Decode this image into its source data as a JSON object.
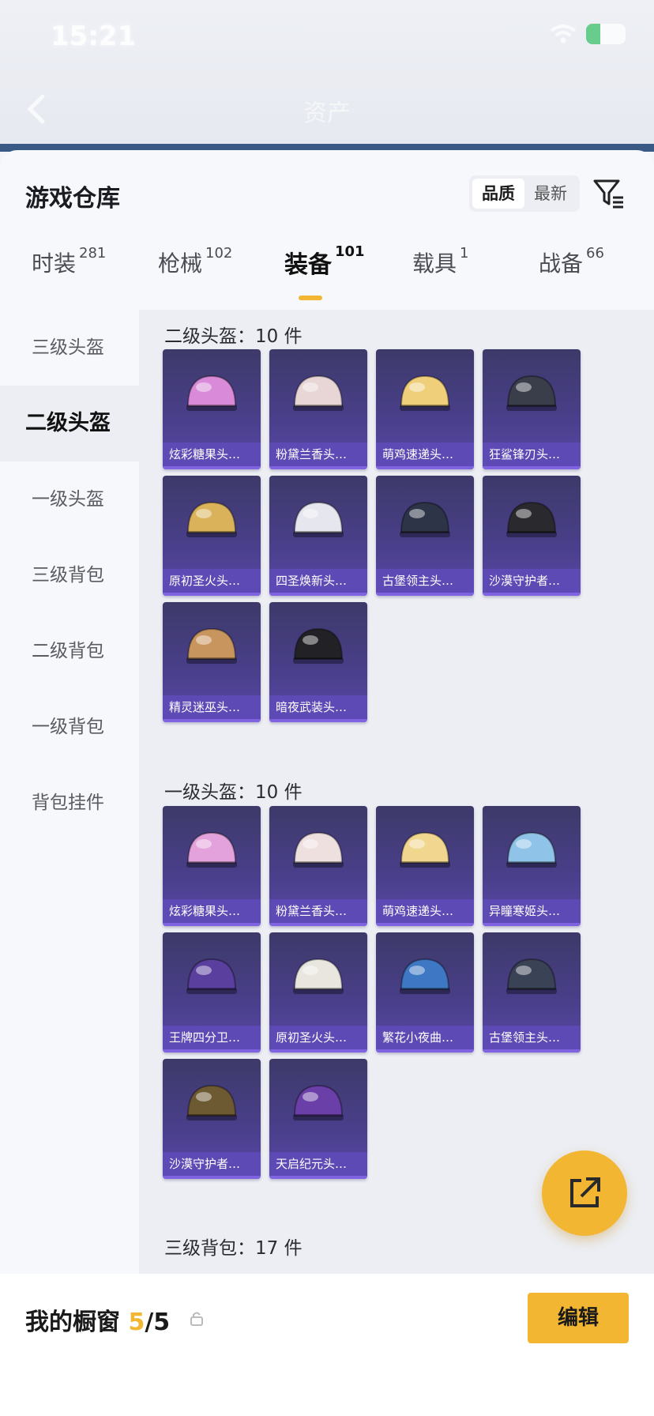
{
  "status_bar": {
    "time": "15:21"
  },
  "nav": {
    "title": "资产"
  },
  "header": {
    "title": "游戏仓库",
    "sort_options": [
      "品质",
      "最新"
    ],
    "active_sort": "品质"
  },
  "tabs": [
    {
      "label": "时装",
      "count": "281"
    },
    {
      "label": "枪械",
      "count": "102"
    },
    {
      "label": "装备",
      "count": "101",
      "active": true
    },
    {
      "label": "载具",
      "count": "1"
    },
    {
      "label": "战备",
      "count": "66"
    }
  ],
  "sidebar": [
    {
      "label": "三级头盔"
    },
    {
      "label": "二级头盔",
      "active": true
    },
    {
      "label": "一级头盔"
    },
    {
      "label": "三级背包"
    },
    {
      "label": "二级背包"
    },
    {
      "label": "一级背包"
    },
    {
      "label": "背包挂件"
    }
  ],
  "sections": [
    {
      "title": "二级头盔：10 件",
      "items": [
        {
          "label": "炫彩糖果头…",
          "color": "#d98ad8"
        },
        {
          "label": "粉黛兰香头…",
          "color": "#e8d6d6"
        },
        {
          "label": "萌鸡速递头…",
          "color": "#efcf7a"
        },
        {
          "label": "狂鲨锋刃头…",
          "color": "#3a3d4a"
        },
        {
          "label": "原初圣火头…",
          "color": "#d9b25a"
        },
        {
          "label": "四圣焕新头…",
          "color": "#e6e6ee"
        },
        {
          "label": "古堡领主头…",
          "color": "#2d3448"
        },
        {
          "label": "沙漠守护者…",
          "color": "#2a2a2e"
        },
        {
          "label": "精灵迷巫头…",
          "color": "#c9955e"
        },
        {
          "label": "暗夜武装头…",
          "color": "#222226"
        }
      ]
    },
    {
      "title": "一级头盔：10 件",
      "items": [
        {
          "label": "炫彩糖果头…",
          "color": "#e3a2dc"
        },
        {
          "label": "粉黛兰香头…",
          "color": "#efe0e0"
        },
        {
          "label": "萌鸡速递头…",
          "color": "#f0d68e"
        },
        {
          "label": "异瞳寒姬头…",
          "color": "#8fc4e8"
        },
        {
          "label": "王牌四分卫…",
          "color": "#5a3f9e"
        },
        {
          "label": "原初圣火头…",
          "color": "#e9e6e0"
        },
        {
          "label": "繁花小夜曲…",
          "color": "#3e77c4"
        },
        {
          "label": "古堡领主头…",
          "color": "#3a4256"
        },
        {
          "label": "沙漠守护者…",
          "color": "#6e5a32"
        },
        {
          "label": "天启纪元头…",
          "color": "#6b3fa8"
        }
      ]
    },
    {
      "title": "三级背包：17 件",
      "items": []
    }
  ],
  "bottom_bar": {
    "label": "我的橱窗",
    "count_current": "5",
    "count_total": "/5",
    "edit_label": "编辑"
  },
  "colors": {
    "accent": "#f2b632",
    "item_bg": "#4a3f8c"
  }
}
